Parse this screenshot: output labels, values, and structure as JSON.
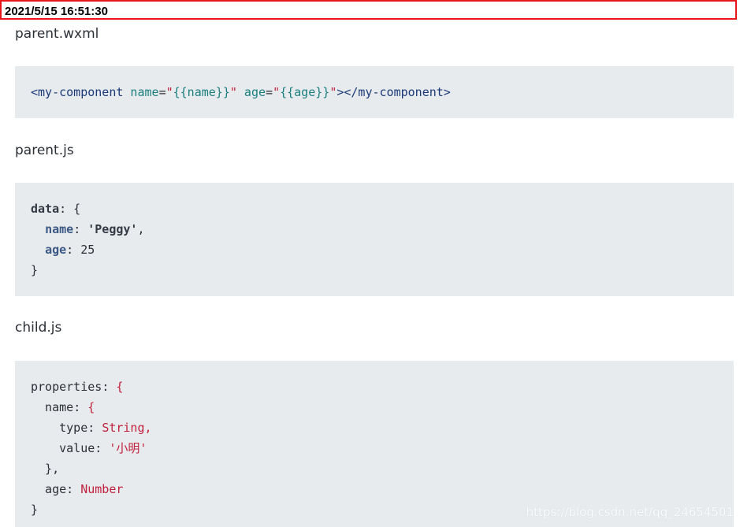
{
  "timestamp": "2021/5/15 16:51:30",
  "sections": [
    {
      "heading": "parent.wxml",
      "lines": [
        {
          "tokens": [
            {
              "text": "<my-component",
              "cls": "tag"
            },
            {
              "text": " name",
              "cls": "attr"
            },
            {
              "text": "=",
              "cls": "plain"
            },
            {
              "text": "\"",
              "cls": "str"
            },
            {
              "text": "{{name}}",
              "cls": "expr"
            },
            {
              "text": "\"",
              "cls": "str"
            },
            {
              "text": " age",
              "cls": "attr"
            },
            {
              "text": "=",
              "cls": "plain"
            },
            {
              "text": "\"",
              "cls": "str"
            },
            {
              "text": "{{age}}",
              "cls": "expr"
            },
            {
              "text": "\"",
              "cls": "str"
            },
            {
              "text": "></my-component>",
              "cls": "tag"
            }
          ]
        }
      ]
    },
    {
      "heading": "parent.js",
      "lines": [
        {
          "tokens": [
            {
              "text": "data",
              "cls": "key-bold"
            },
            {
              "text": ": {",
              "cls": "punct"
            }
          ]
        },
        {
          "tokens": [
            {
              "text": "  ",
              "cls": "plain"
            },
            {
              "text": "name",
              "cls": "key-blue"
            },
            {
              "text": ": ",
              "cls": "punct"
            },
            {
              "text": "'Peggy'",
              "cls": "val-bold"
            },
            {
              "text": ",",
              "cls": "punct"
            }
          ]
        },
        {
          "tokens": [
            {
              "text": "  ",
              "cls": "plain"
            },
            {
              "text": "age",
              "cls": "key-blue"
            },
            {
              "text": ": 25",
              "cls": "punct"
            }
          ]
        },
        {
          "tokens": [
            {
              "text": "}",
              "cls": "punct"
            }
          ]
        }
      ]
    },
    {
      "heading": "child.js",
      "lines": [
        {
          "tokens": [
            {
              "text": "properties",
              "cls": "plain"
            },
            {
              "text": ": ",
              "cls": "plain"
            },
            {
              "text": "{",
              "cls": "red"
            }
          ]
        },
        {
          "tokens": [
            {
              "text": "  name",
              "cls": "plain"
            },
            {
              "text": ": ",
              "cls": "plain"
            },
            {
              "text": "{",
              "cls": "red"
            }
          ]
        },
        {
          "tokens": [
            {
              "text": "    type",
              "cls": "plain"
            },
            {
              "text": ": ",
              "cls": "plain"
            },
            {
              "text": "String,",
              "cls": "red"
            }
          ]
        },
        {
          "tokens": [
            {
              "text": "    value",
              "cls": "plain"
            },
            {
              "text": ": ",
              "cls": "plain"
            },
            {
              "text": "'小明'",
              "cls": "red"
            }
          ]
        },
        {
          "tokens": [
            {
              "text": "  },",
              "cls": "plain"
            }
          ]
        },
        {
          "tokens": [
            {
              "text": "  age",
              "cls": "plain"
            },
            {
              "text": ": ",
              "cls": "plain"
            },
            {
              "text": "Number",
              "cls": "red"
            }
          ]
        },
        {
          "tokens": [
            {
              "text": "}",
              "cls": "plain"
            }
          ]
        }
      ]
    }
  ],
  "watermark": "https://blog.csdn.net/qq_24654501"
}
